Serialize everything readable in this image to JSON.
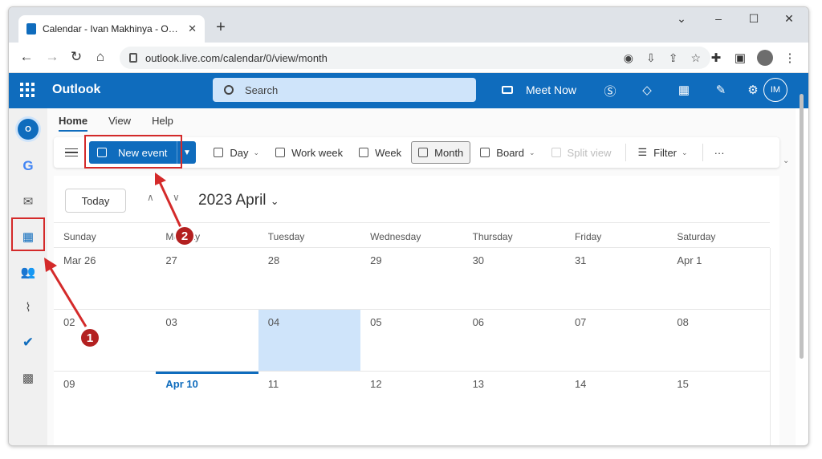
{
  "browser": {
    "tab_title": "Calendar - Ivan Makhinya - Outlo",
    "new_tab": "+",
    "url": "outlook.live.com/calendar/0/view/month",
    "window_controls": [
      "⌄",
      "–",
      "☐",
      "✕"
    ]
  },
  "outlook": {
    "brand": "Outlook",
    "search_placeholder": "Search",
    "meet_now": "Meet Now",
    "account_initials": "IM"
  },
  "ribbon": {
    "tabs": [
      "Home",
      "View",
      "Help"
    ],
    "new_event": "New event",
    "day": "Day",
    "work_week": "Work week",
    "week": "Week",
    "month": "Month",
    "board": "Board",
    "split_view": "Split view",
    "filter": "Filter",
    "more": "···"
  },
  "calendar": {
    "today_button": "Today",
    "month_title": "2023 April",
    "weekdays": [
      "Sunday",
      "Monday",
      "Tuesday",
      "Wednesday",
      "Thursday",
      "Friday",
      "Saturday"
    ],
    "weeks": [
      [
        "Mar 26",
        "27",
        "28",
        "29",
        "30",
        "31",
        "Apr 1"
      ],
      [
        "02",
        "03",
        "04",
        "05",
        "06",
        "07",
        "08"
      ],
      [
        "09",
        "Apr 10",
        "11",
        "12",
        "13",
        "14",
        "15"
      ]
    ],
    "today_cell": "04",
    "selected_cell": "Apr 10"
  },
  "annotations": {
    "badge_1": "1",
    "badge_2": "2",
    "highlight_color": "#d42a2a"
  },
  "colors": {
    "accent": "#0f6cbd",
    "today_fill": "#cfe4fa"
  }
}
